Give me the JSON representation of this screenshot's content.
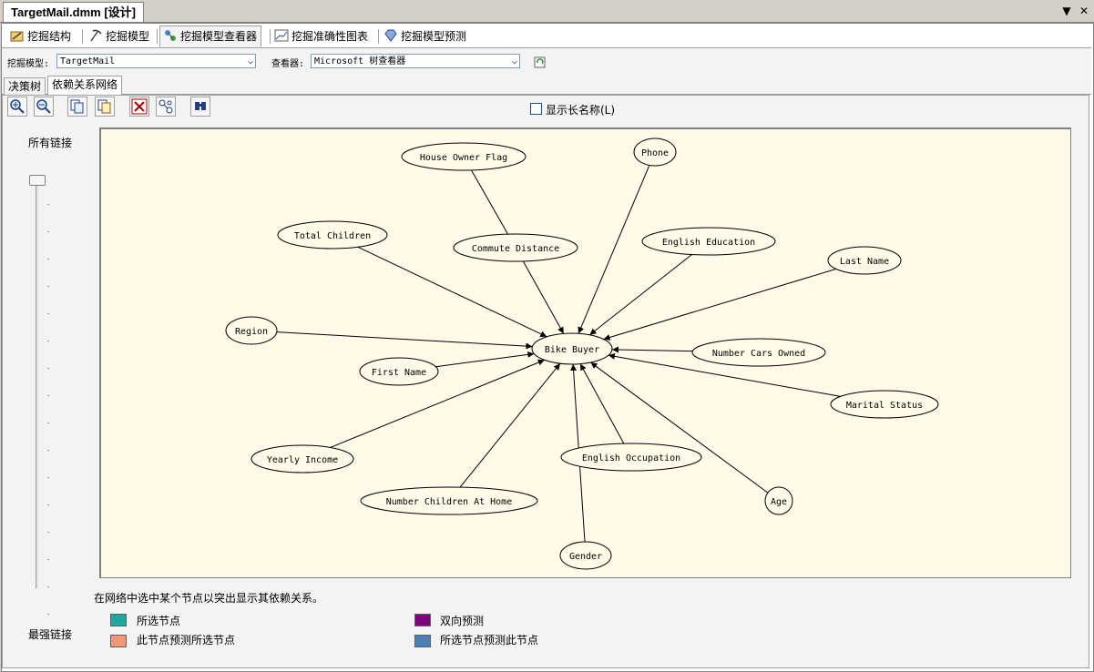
{
  "document": {
    "title": "TargetMail.dmm [设计]"
  },
  "window_controls": {
    "dropdown": "▼",
    "close": "✕"
  },
  "top_tabs": [
    {
      "label": "挖掘结构"
    },
    {
      "label": "挖掘模型"
    },
    {
      "label": "挖掘模型查看器"
    },
    {
      "label": "挖掘准确性图表"
    },
    {
      "label": "挖掘模型预测"
    }
  ],
  "selectors": {
    "model_label": "挖掘模型:",
    "model_value": "TargetMail",
    "viewer_label": "查看器:",
    "viewer_value": "Microsoft 树查看器"
  },
  "inner_tabs": [
    {
      "label": "决策树"
    },
    {
      "label": "依赖关系网络"
    }
  ],
  "toolbar": {
    "show_long_names": "显示长名称(L)",
    "show_long_names_checked": false
  },
  "slider": {
    "top_label": "所有链接",
    "bottom_label": "最强链接",
    "level": 1.0
  },
  "network": {
    "center": "Bike Buyer",
    "nodes": [
      "House Owner Flag",
      "Phone",
      "Total Children",
      "Commute Distance",
      "English Education",
      "Last Name",
      "Region",
      "Number Cars Owned",
      "First Name",
      "Marital Status",
      "Yearly Income",
      "English Occupation",
      "Age",
      "Number Children At Home",
      "Gender"
    ]
  },
  "hint": "在网络中选中某个节点以突出显示其依赖关系。",
  "legend": [
    {
      "label": "所选节点",
      "color": "#20a8a0"
    },
    {
      "label": "双向预测",
      "color": "#800080"
    },
    {
      "label": "此节点预测所选节点",
      "color": "#f09878"
    },
    {
      "label": "所选节点预测此节点",
      "color": "#4a7fb8"
    }
  ]
}
